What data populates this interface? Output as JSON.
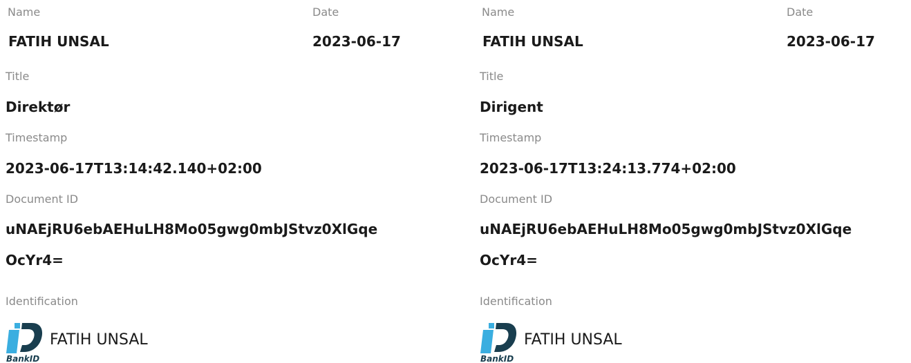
{
  "signatures": [
    {
      "name_label": "Name",
      "name_value": "FATIH UNSAL",
      "date_label": "Date",
      "date_value": "2023-06-17",
      "title_label": "Title",
      "title_value": "Direktør",
      "timestamp_label": "Timestamp",
      "timestamp_value": "2023-06-17T13:14:42.140+02:00",
      "document_id_label": "Document ID",
      "document_id_line1": "uNAEjRU6ebAEHuLH8Mo05gwg0mbJStvz0XlGqe",
      "document_id_line2": "OcYr4=",
      "identification_label": "Identification",
      "identification_provider": "BankID",
      "identification_name": "FATIH UNSAL",
      "logo_icon": "bankid-logo-icon"
    },
    {
      "name_label": "Name",
      "name_value": "FATIH UNSAL",
      "date_label": "Date",
      "date_value": "2023-06-17",
      "title_label": "Title",
      "title_value": "Dirigent",
      "timestamp_label": "Timestamp",
      "timestamp_value": "2023-06-17T13:24:13.774+02:00",
      "document_id_label": "Document ID",
      "document_id_line1": "uNAEjRU6ebAEHuLH8Mo05gwg0mbJStvz0XlGqe",
      "document_id_line2": "OcYr4=",
      "identification_label": "Identification",
      "identification_provider": "BankID",
      "identification_name": "FATIH UNSAL",
      "logo_icon": "bankid-logo-icon"
    }
  ],
  "colors": {
    "label": "#8a8a8a",
    "value": "#1a1a1a",
    "bankid_blue": "#3aaee0",
    "bankid_navy": "#193e4f"
  }
}
